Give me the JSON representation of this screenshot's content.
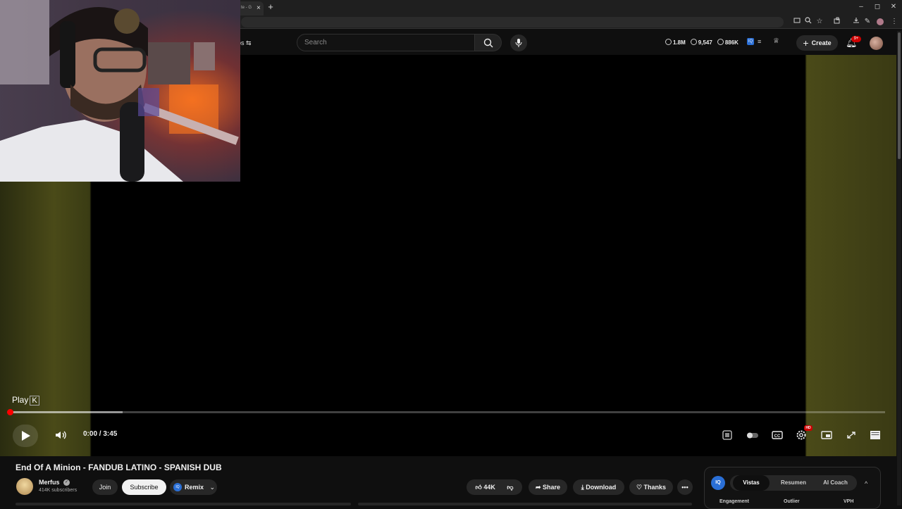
{
  "browser": {
    "tab_title": "te - G",
    "tab_close": "×",
    "new_tab": "+",
    "window_controls": [
      "–",
      "◻",
      "✕"
    ],
    "toolbar_icons": [
      "cast-icon",
      "zoom-icon",
      "star-icon",
      "extensions-icon",
      "download-icon",
      "pen-icon",
      "profile-icon",
      "menu-icon"
    ]
  },
  "header": {
    "chip_label": "ros",
    "search_placeholder": "Search",
    "stats": {
      "watch_time": "1.8M",
      "views": "9,547",
      "subscribers_views": "886K"
    },
    "create_label": "Create",
    "notification_badge": "9+"
  },
  "player": {
    "tooltip_label": "Play",
    "tooltip_key": "K",
    "time_current": "0:00",
    "time_separator": " / ",
    "time_total": "3:45",
    "time_display": "0:00 / 3:45",
    "quality_badge": "HD",
    "buffer_fraction": 0.13
  },
  "video": {
    "title": "End Of A Minion - FANDUB LATINO - SPANISH DUB",
    "channel": "Merfus",
    "subscribers": "414K subscribers",
    "join_label": "Join",
    "subscribe_label": "Subscribe",
    "remix_label": "Remix",
    "likes": "44K",
    "share_label": "Share",
    "download_label": "Download",
    "thanks_label": "Thanks",
    "more_label": "•••"
  },
  "panel": {
    "logo": "IQ",
    "tabs": [
      "Vistas",
      "Resumen",
      "AI Coach"
    ],
    "columns": [
      "Engagement",
      "Outlier",
      "VPH"
    ],
    "collapse": "^"
  }
}
